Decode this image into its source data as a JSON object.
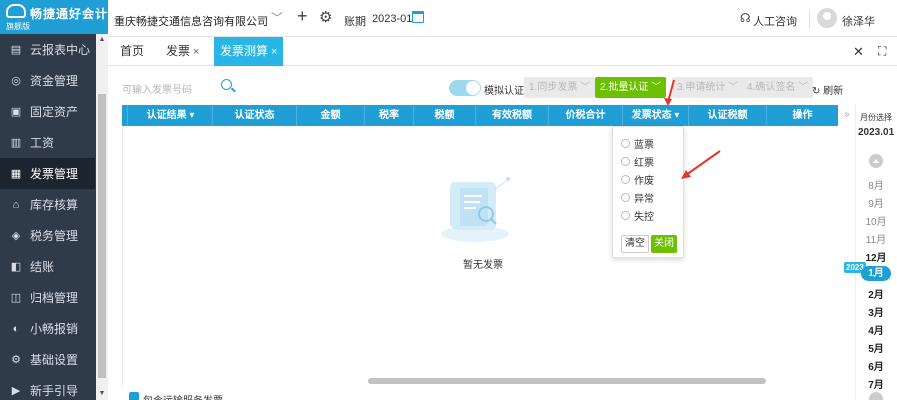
{
  "app": {
    "logo_name": "畅捷通好会计",
    "logo_edition": "旗舰版"
  },
  "sidebar": {
    "items": [
      {
        "label": "云报表中心",
        "icon": "report-icon"
      },
      {
        "label": "资金管理",
        "icon": "money-icon"
      },
      {
        "label": "固定资产",
        "icon": "asset-icon"
      },
      {
        "label": "工资",
        "icon": "salary-icon"
      },
      {
        "label": "发票管理",
        "icon": "invoice-icon"
      },
      {
        "label": "库存核算",
        "icon": "warehouse-icon"
      },
      {
        "label": "税务管理",
        "icon": "tax-icon"
      },
      {
        "label": "结账",
        "icon": "checkout-icon"
      },
      {
        "label": "归档管理",
        "icon": "archive-icon"
      },
      {
        "label": "小畅报销",
        "icon": "reimburse-icon"
      },
      {
        "label": "基础设置",
        "icon": "settings-icon"
      },
      {
        "label": "新手引导",
        "icon": "guide-icon"
      }
    ],
    "active_index": 4
  },
  "topbar": {
    "company": "重庆畅捷交通信息咨询有限公司",
    "period_label": "账期",
    "period_value": "2023-01",
    "support": "人工咨询",
    "username": "徐泽华"
  },
  "tabs": [
    {
      "label": "首页",
      "closable": false,
      "active": false
    },
    {
      "label": "发票",
      "closable": true,
      "active": false
    },
    {
      "label": "发票测算",
      "closable": true,
      "active": true
    }
  ],
  "toolbar": {
    "search_placeholder": "可输入发票号码",
    "toggle_label": "模拟认证",
    "btn_sync": "1.同步发票",
    "btn_batch": "2.批量认证",
    "btn_apply": "3.申请统计",
    "btn_confirm": "4.确认签名",
    "refresh": "刷新"
  },
  "table": {
    "columns": [
      "认证结果",
      "认证状态",
      "金额",
      "税率",
      "税额",
      "有效税额",
      "价税合计",
      "发票状态",
      "认证税额",
      "操作"
    ],
    "empty_text": "暂无发票"
  },
  "dropdown": {
    "options": [
      "蓝票",
      "红票",
      "作废",
      "异常",
      "失控"
    ],
    "clear": "清空",
    "close": "关闭"
  },
  "footer": {
    "checkbox_label": "包含运输服务发票",
    "checked": true
  },
  "month_panel": {
    "title": "月份选择",
    "year": "2023.01",
    "year_badge": "2023",
    "months": [
      "8月",
      "9月",
      "10月",
      "11月",
      "12月",
      "1月",
      "2月",
      "3月",
      "4月",
      "5月",
      "6月",
      "7月"
    ],
    "selected_index": 5
  },
  "colors": {
    "sidebar_bg": "#303b4a",
    "brand_blue": "#1f9fd6",
    "primary_green": "#6cc000",
    "annotation_red": "#e8342b"
  }
}
